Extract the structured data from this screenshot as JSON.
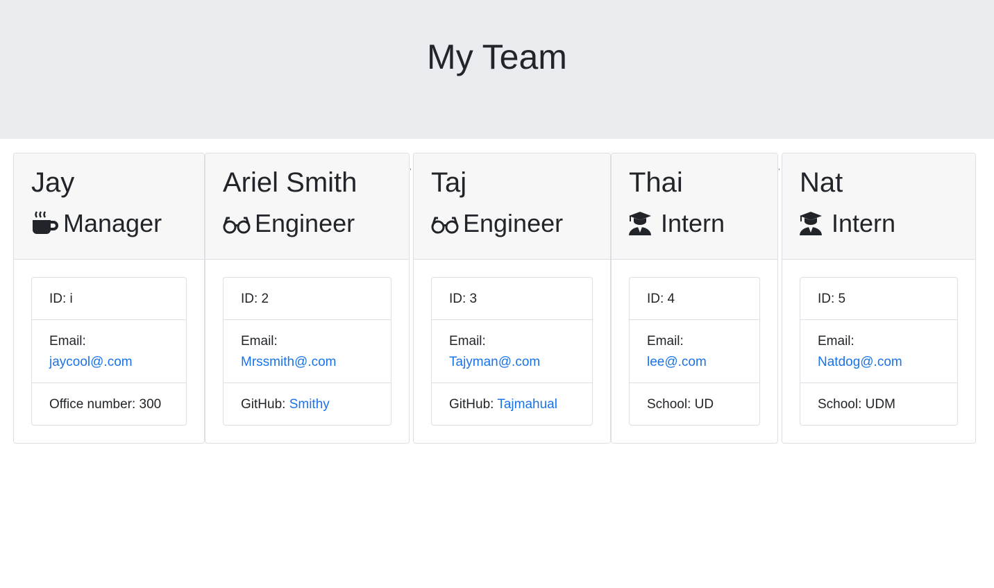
{
  "header": {
    "title": "My Team"
  },
  "cards": [
    {
      "name": "Jay",
      "role": "Manager",
      "role_icon": "coffee-mug-icon",
      "id_text": "ID: i",
      "email_label": "Email:",
      "email": "jaycool@.com",
      "extra_label": "Office number: 300",
      "extra_link": ""
    },
    {
      "name": "Ariel Smith",
      "role": "Engineer",
      "role_icon": "glasses-icon",
      "id_text": "ID: 2",
      "email_label": "Email:",
      "email": "Mrssmith@.com",
      "extra_label": "GitHub: ",
      "extra_link": "Smithy"
    },
    {
      "name": "Taj",
      "role": "Engineer",
      "role_icon": "glasses-icon",
      "id_text": "ID: 3",
      "email_label": "Email:",
      "email": "Tajyman@.com",
      "extra_label": "GitHub: ",
      "extra_link": "Tajmahual"
    },
    {
      "name": "Thai",
      "role": "Intern",
      "role_icon": "graduate-icon",
      "id_text": "ID: 4",
      "email_label": "Email:",
      "email": "lee@.com",
      "extra_label": "School: UD",
      "extra_link": ""
    },
    {
      "name": "Nat",
      "role": "Intern",
      "role_icon": "graduate-icon",
      "id_text": "ID: 5",
      "email_label": "Email:",
      "email": "Natdog@.com",
      "extra_label": "School: UDM",
      "extra_link": ""
    }
  ],
  "stray_marks": [
    ",",
    ","
  ],
  "colors": {
    "link": "#1a73e8",
    "jumbotron_bg": "#e9ecef",
    "card_header_bg": "#f7f7f7"
  }
}
